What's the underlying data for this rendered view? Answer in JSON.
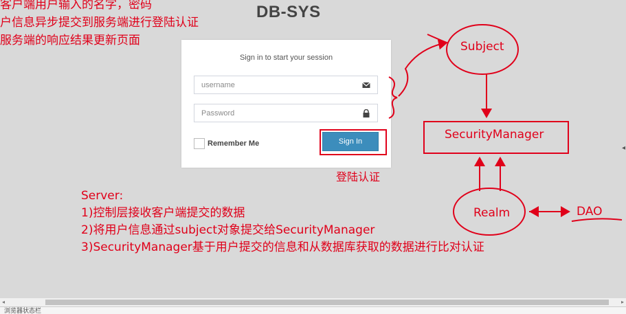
{
  "brand": {
    "title": "DB-SYS"
  },
  "annotations": {
    "top_lines": [
      "客户端用户输入的名字，密码",
      "户信息异步提交到服务端进行登陆认证",
      "服务端的响应结果更新页面"
    ],
    "signin_note": "登陆认证",
    "server_notes": [
      "Server:",
      "1)控制层接收客户端提交的数据",
      "2)将用户信息通过subject对象提交给SecurityManager",
      "3)SecurityManager基于用户提交的信息和从数据库获取的数据进行比对认证"
    ]
  },
  "login": {
    "message": "Sign in to start your session",
    "username_placeholder": "username",
    "password_placeholder": "Password",
    "remember_label": "Remember Me",
    "signin_label": "Sign In"
  },
  "diagram": {
    "subject": "Subject",
    "security_manager": "SecurityManager",
    "realm": "Realm",
    "dao": "DAO"
  },
  "status_bar": {
    "text": "浏览器状态栏"
  },
  "icons": {
    "username": "envelope-icon",
    "password": "lock-icon"
  },
  "colors": {
    "annotation": "#e0001a",
    "button": "#3c8dbc",
    "background": "#d9d9d9"
  }
}
